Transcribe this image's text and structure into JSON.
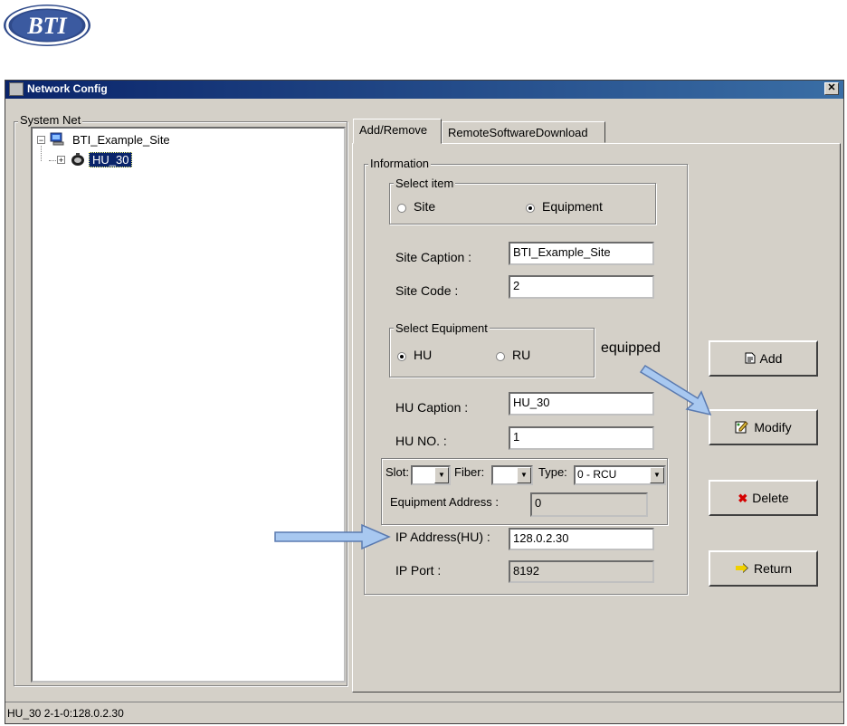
{
  "logo": {
    "text": "BTI"
  },
  "window": {
    "title": "Network Config",
    "close_glyph": "✕"
  },
  "system_net": {
    "legend": "System Net",
    "tree": [
      {
        "label": "BTI_Example_Site",
        "expander": "−",
        "icon": "computer-icon"
      },
      {
        "label": "HU_30",
        "expander": "+",
        "icon": "equipment-icon",
        "selected": true
      }
    ]
  },
  "tabs": [
    {
      "label": "Add/Remove",
      "active": true
    },
    {
      "label": "RemoteSoftwareDownload",
      "active": false
    }
  ],
  "information": {
    "legend": "Information",
    "select_item": {
      "legend": "Select item",
      "options": [
        {
          "label": "Site",
          "selected": false
        },
        {
          "label": "Equipment",
          "selected": true
        }
      ]
    },
    "site_caption": {
      "label": "Site Caption :",
      "value": "BTI_Example_Site"
    },
    "site_code": {
      "label": "Site Code :",
      "value": "2"
    },
    "select_equipment": {
      "legend": "Select Equipment",
      "options": [
        {
          "label": "HU",
          "selected": true
        },
        {
          "label": "RU",
          "selected": false
        }
      ]
    },
    "hu_caption": {
      "label": "HU Caption :",
      "value": "HU_30"
    },
    "hu_no": {
      "label": "HU NO. :",
      "value": "1"
    },
    "slot": {
      "label": "Slot:",
      "value": ""
    },
    "fiber": {
      "label": "Fiber:",
      "value": ""
    },
    "type": {
      "label": "Type:",
      "value": "0 - RCU"
    },
    "equipment_address": {
      "label": "Equipment Address :",
      "value": "0"
    },
    "ip_address": {
      "label": "IP Address(HU) :",
      "value": "128.0.2.30"
    },
    "ip_port": {
      "label": "IP Port :",
      "value": "8192"
    }
  },
  "annotation": {
    "text": "equipped"
  },
  "buttons": {
    "add": {
      "label": "Add",
      "icon": "document-icon"
    },
    "modify": {
      "label": "Modify",
      "icon": "edit-icon"
    },
    "delete": {
      "label": "Delete",
      "icon": "x-icon"
    },
    "return": {
      "label": "Return",
      "icon": "return-arrow-icon"
    }
  },
  "status": {
    "text": "HU_30 2-1-0:128.0.2.30"
  },
  "colors": {
    "selection": "#0a246a",
    "titlebar": "#0a246a",
    "arrow": "#a8c8f0",
    "delete_icon": "#d40000"
  }
}
